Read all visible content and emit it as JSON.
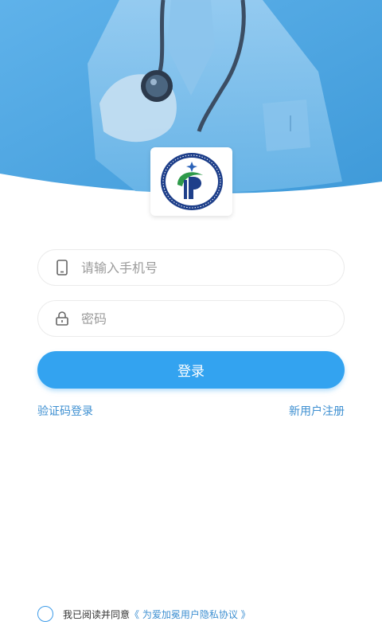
{
  "login": {
    "phone_placeholder": "请输入手机号",
    "password_placeholder": "密码",
    "login_label": "登录",
    "sms_login_label": "验证码登录",
    "register_label": "新用户注册"
  },
  "agreement": {
    "prefix": "我已阅读并同意",
    "policy": "《 为爱加冕用户隐私协议 》"
  },
  "icons": {
    "phone": "phone-icon",
    "lock": "lock-icon",
    "logo": "hospital-logo"
  },
  "colors": {
    "primary": "#33a3f0",
    "link": "#3d8fd1",
    "hero": "#4aa3e2"
  }
}
